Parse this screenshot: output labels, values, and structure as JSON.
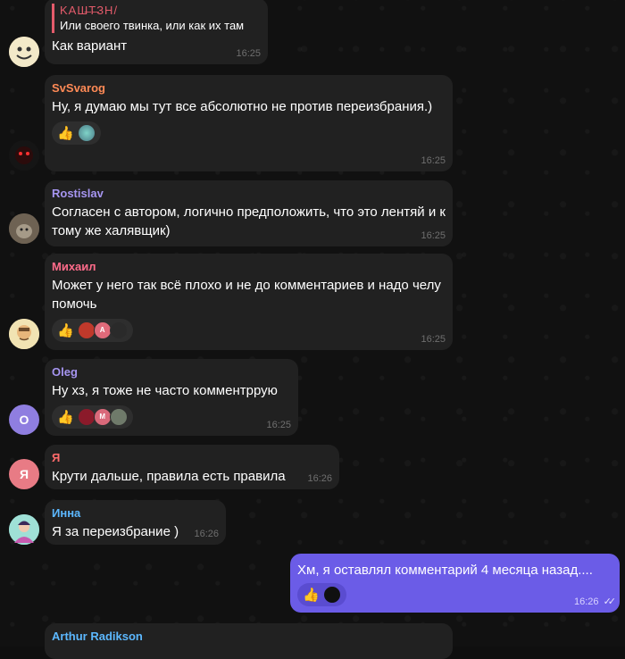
{
  "messages": [
    {
      "id": "m1",
      "reply_name": "KAШ̶Т̶ЗН/",
      "reply_text": "Или своего твинка, или как их там",
      "text": "Как вариант",
      "time": "16:25"
    },
    {
      "id": "m2",
      "sender": "SvSvarog",
      "sender_color": "#ff8a56",
      "text": "Ну, я думаю мы тут все абсолютно не против переизбрания.)",
      "reactions": [
        "thumbs-up",
        "avatar"
      ],
      "time": "16:25"
    },
    {
      "id": "m3",
      "sender": "Rostislav",
      "sender_color": "#a695f0",
      "text": "Согласен с автором, логично предположить, что это лентяй и к тому же халявщик)",
      "time": "16:25"
    },
    {
      "id": "m4",
      "sender": "Михаил",
      "sender_color": "#ff6b8a",
      "text": "Может у него так всё плохо и не до комментариев и надо челу помочь",
      "reactions": [
        "thumbs-up",
        "avatar",
        "avatar",
        "avatar"
      ],
      "reaction_letter": "A",
      "time": "16:25"
    },
    {
      "id": "m5",
      "sender": "Oleg",
      "sender_color": "#a695f0",
      "text": "Ну хз, я тоже не часто комментррую",
      "reactions": [
        "thumbs-up",
        "avatar",
        "avatar",
        "avatar"
      ],
      "reaction_letter": "M",
      "avatar_letter": "O",
      "time": "16:25"
    },
    {
      "id": "m6",
      "sender": "Я",
      "sender_color": "#ff6b6b",
      "text": "Крути дальше, правила есть правила",
      "avatar_letter": "Я",
      "time": "16:26"
    },
    {
      "id": "m7",
      "sender": "Инна",
      "sender_color": "#5cb8ff",
      "text": "Я за переизбрание )",
      "time": "16:26"
    },
    {
      "id": "m8",
      "own": true,
      "text": "Хм, я оставлял комментарий 4 месяца назад....",
      "reactions": [
        "thumbs-up",
        "avatar"
      ],
      "time": "16:26"
    },
    {
      "id": "m9",
      "sender": "Arthur Radikson",
      "sender_color": "#5cb8ff"
    }
  ],
  "icons": {
    "thumbs_up": "👍",
    "read_checks": "✓✓"
  }
}
